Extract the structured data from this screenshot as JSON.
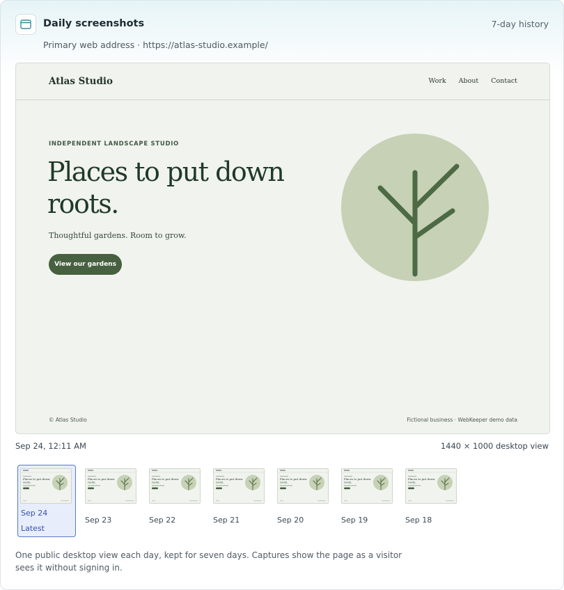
{
  "header": {
    "title": "Daily screenshots",
    "history_label": "7-day history",
    "subtitle": "Primary web address · https://atlas-studio.example/",
    "icon": "browser-window-icon"
  },
  "preview": {
    "site": {
      "logo": "Atlas Studio",
      "nav": [
        "Work",
        "About",
        "Contact"
      ],
      "eyebrow": "INDEPENDENT LANDSCAPE STUDIO",
      "headline": "Places to put down roots.",
      "tagline": "Thoughtful gardens. Room to grow.",
      "cta_label": "View our gardens",
      "footer_left": "© Atlas Studio",
      "footer_right": "Fictional business · WebKeeper demo data",
      "colors": {
        "background": "#f1f3ee",
        "accent": "#47603f",
        "circle": "#c6d1b5"
      }
    },
    "capture_time": "Sep 24, 12:11 AM",
    "capture_size": "1440 × 1000 desktop view"
  },
  "thumbnails": [
    {
      "date": "Sep 24",
      "latest_label": "Latest",
      "selected": true
    },
    {
      "date": "Sep 23",
      "selected": false
    },
    {
      "date": "Sep 22",
      "selected": false
    },
    {
      "date": "Sep 21",
      "selected": false
    },
    {
      "date": "Sep 20",
      "selected": false
    },
    {
      "date": "Sep 19",
      "selected": false
    },
    {
      "date": "Sep 18",
      "selected": false
    }
  ],
  "footnote": "One public desktop view each day, kept for seven days. Captures show the page as a visitor sees it without signing in.",
  "colors": {
    "selection": "#5a78c9",
    "selection_bg": "#e8edfc"
  }
}
